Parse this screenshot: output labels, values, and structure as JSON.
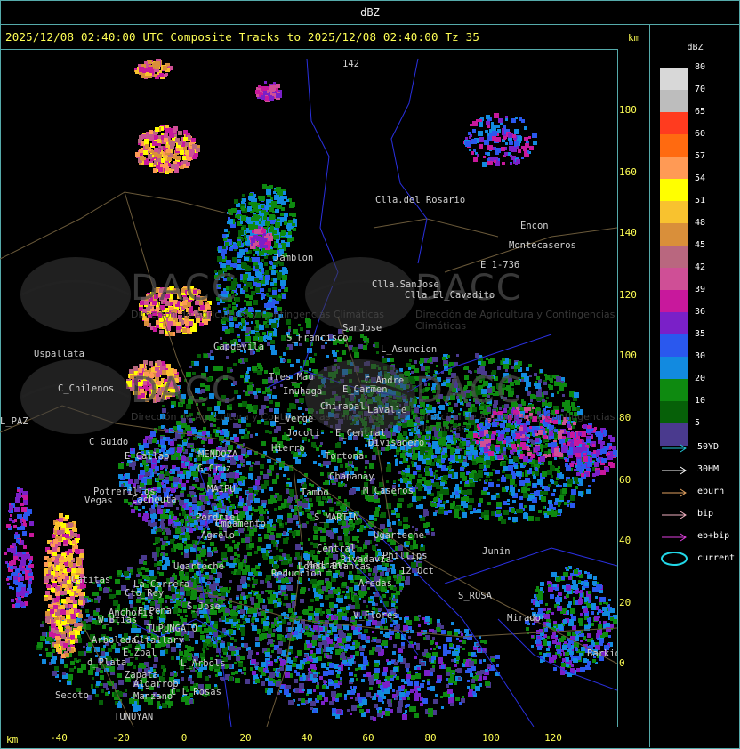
{
  "window": {
    "title": "dBZ"
  },
  "header": {
    "text": "2025/12/08 02:40:00 UTC Composite Tracks to 2025/12/08 02:40:00 Tz 35",
    "km_top": "km",
    "km_bottom": "km"
  },
  "axes": {
    "y_ticks": [
      "180",
      "160",
      "140",
      "120",
      "100",
      "80",
      "60",
      "40",
      "20",
      "0"
    ],
    "x_ticks": [
      "-40",
      "-20",
      "0",
      "20",
      "40",
      "60",
      "80",
      "100",
      "120"
    ]
  },
  "legend": {
    "title": "dBZ",
    "scale": [
      {
        "label": "80",
        "color": "#d8d8d8"
      },
      {
        "label": "70",
        "color": "#bdbdbd"
      },
      {
        "label": "65",
        "color": "#ff3b1f"
      },
      {
        "label": "60",
        "color": "#ff6a10"
      },
      {
        "label": "57",
        "color": "#ff9a55"
      },
      {
        "label": "54",
        "color": "#ffff00"
      },
      {
        "label": "51",
        "color": "#f8c22f"
      },
      {
        "label": "48",
        "color": "#d98f3a"
      },
      {
        "label": "45",
        "color": "#b9677f"
      },
      {
        "label": "42",
        "color": "#cf4f96"
      },
      {
        "label": "39",
        "color": "#c8189c"
      },
      {
        "label": "36",
        "color": "#7a20c8"
      },
      {
        "label": "35",
        "color": "#2a58ee"
      },
      {
        "label": "30",
        "color": "#128ae0"
      },
      {
        "label": "20",
        "color": "#0e8a10"
      },
      {
        "label": "10",
        "color": "#066008"
      },
      {
        "label": "5",
        "color": "#4a3a8e"
      }
    ],
    "tracks": [
      {
        "label": "50YD",
        "color": "#22c6d8"
      },
      {
        "label": "30HM",
        "color": "#ffffff"
      },
      {
        "label": "eburn",
        "color": "#e0a060"
      },
      {
        "label": "bip",
        "color": "#f0b0c0"
      },
      {
        "label": "eb+bip",
        "color": "#e040e0"
      }
    ],
    "current_label": "current",
    "current_color": "#22d8e8"
  },
  "watermarks": [
    {
      "text": "DACC",
      "sub": "Dirección de Agricultura y Contingencias Climáticas"
    },
    {
      "text": "DACC",
      "sub": "Dirección de Agricultura y Contingencias Climáticas"
    },
    {
      "text": "DACC",
      "sub": "Dirección de Agricultura y Contingencias Climáticas"
    },
    {
      "text": "DACC",
      "sub": "Dirección de Agricultura y Contingencias Climáticas"
    }
  ],
  "places": [
    "Clla.del_Rosario",
    "Encon",
    "E_1-736",
    "Clla.SanJose",
    "Clla.El_Cavadito",
    "Jamblon",
    "Uspallata",
    "Capdevila",
    "S_Francisco",
    "SanJose",
    "L_Asuncion",
    "C_Chilenos",
    "Tres_Mau",
    "Inuhaga",
    "E_Carmen",
    "C_Andre",
    "Chirapal",
    "Lavalle",
    "E_Verge",
    "Jocoli",
    "E_Central",
    "Divisadero",
    "C_Guido",
    "E_Callao",
    "MENDOZA",
    "Hierro",
    "G_Cruz",
    "Tortona",
    "Chapanay",
    "Potrerillos",
    "Cacheuta",
    "Vegas",
    "MAIPU",
    "Ugarteche",
    "Perdriel",
    "Agrelo",
    "S_MARTIN",
    "M_Caseros",
    "Tambo",
    "Junin",
    "Lomas_Blancas",
    "Reduccion",
    "Medrano",
    "Rivadavia",
    "Phillips",
    "12_Oct",
    "S_ROSA",
    "Catitas",
    "La_Carrera",
    "Cto_Rey",
    "S_Jose",
    "Anchoris",
    "E_Pena",
    "W_Btias",
    "TUPUNGATO",
    "Arboleda",
    "Gltallary",
    "E_Zpal",
    "d_Plata",
    "L_Arbols",
    "Zapata",
    "Algarrob",
    "Secoto",
    "Manzano",
    "C_L_Rosas",
    "TUNUYAN",
    "V_Flores",
    "Mirador",
    "Barkida",
    "L_PAZ",
    "Aredas",
    "Central",
    "Cmpamento",
    "Ugarteche",
    "Montecaseros",
    "142"
  ]
}
